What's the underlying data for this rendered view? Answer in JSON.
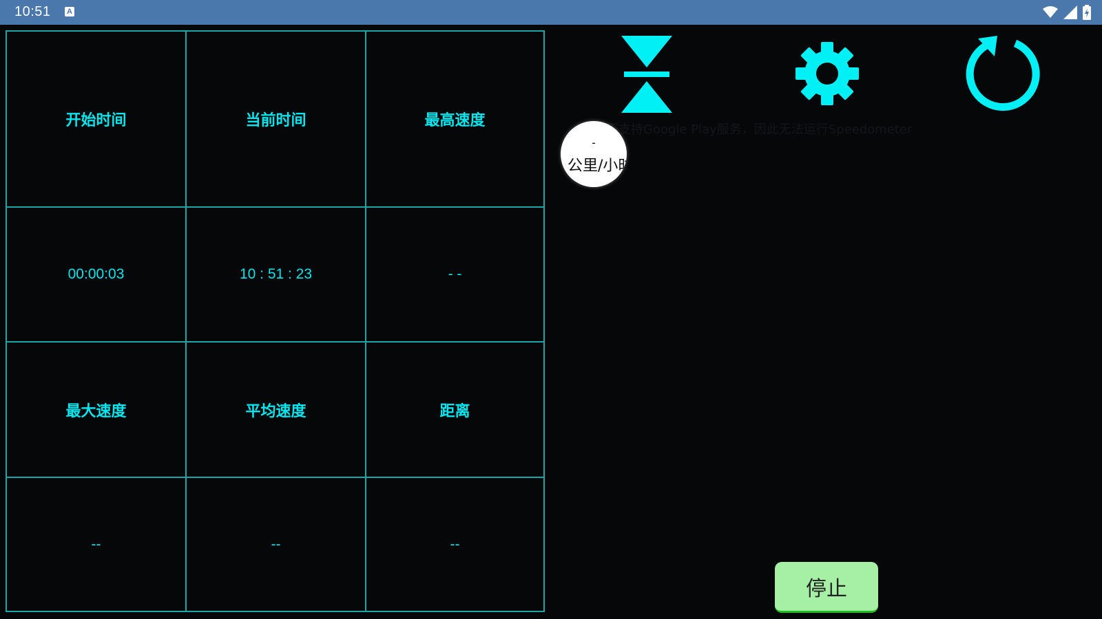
{
  "status_bar": {
    "time": "10:51",
    "notification_icon": "A",
    "icons": [
      "wifi-icon",
      "signal-icon",
      "battery-charging-icon"
    ]
  },
  "colors": {
    "accent": "#00e6ee",
    "grid_line": "#1aa7a7",
    "background": "#060709",
    "status_bar": "#4a78ad",
    "stop_button": "#a6f0a6"
  },
  "stats": {
    "row1": [
      {
        "label": "开始时间",
        "value": "00:00:03"
      },
      {
        "label": "当前时间",
        "value": "10 : 51 : 23"
      },
      {
        "label": "最高速度",
        "value": "- -"
      }
    ],
    "row2": [
      {
        "label": "最大速度",
        "value": "--"
      },
      {
        "label": "平均速度",
        "value": "--"
      },
      {
        "label": "距离",
        "value": "--"
      }
    ]
  },
  "toolbar": {
    "icons": [
      "hourglass-icon",
      "gear-icon",
      "refresh-icon"
    ]
  },
  "hint": {
    "text": "不支持Google Play服务，因此无法运行Speedometer"
  },
  "speed_bubble": {
    "value": "-",
    "unit": "公里/小时"
  },
  "stop_button": {
    "label": "停止"
  }
}
